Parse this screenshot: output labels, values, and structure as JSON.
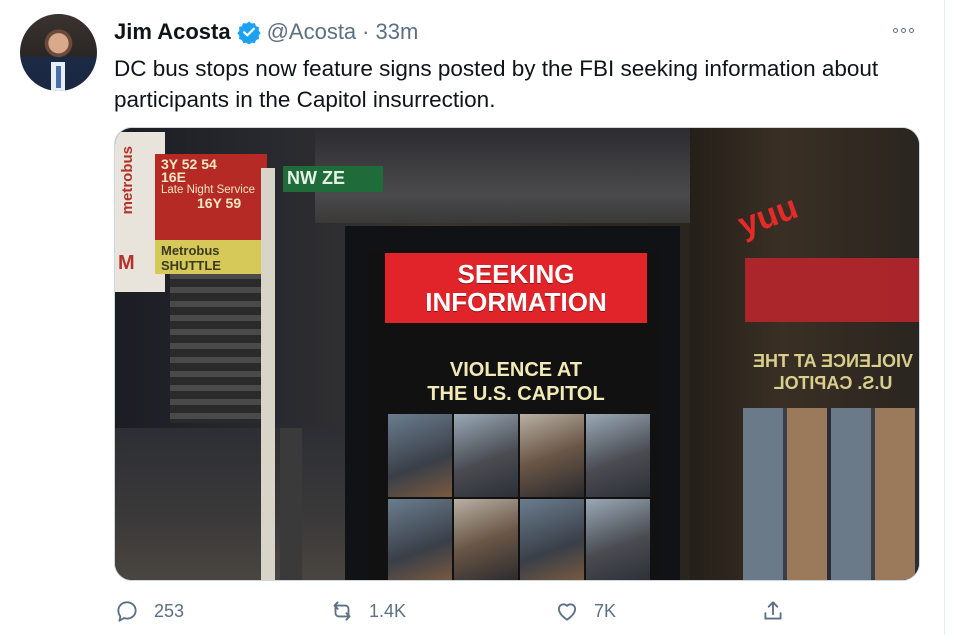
{
  "tweet": {
    "author": {
      "name": "Jim Acosta",
      "handle": "@Acosta",
      "separator": "·",
      "time": "33m"
    },
    "text": "DC bus stops now feature signs posted by the FBI seeking information about participants in the Capitol insurrection.",
    "media": {
      "ad_banner": "SEEKING INFORMATION",
      "ad_subtitle_line1": "VIOLENCE AT",
      "ad_subtitle_line2": "THE U.S. CAPITOL",
      "reflection_text": "VIOLENCE AT THE U.S. CAPITOL",
      "metro_sign": "metrobus",
      "metro_logo": "M",
      "route_sign_line1": "3Y 52 54",
      "route_sign_line2": "16E",
      "route_sign_line3": "Late Night Service",
      "route_sign_line4": "16Y 59",
      "route_yellow_line1": "Metrobus",
      "route_yellow_line2": "SHUTTLE",
      "street_sign": "NW ZE",
      "neon": "yuu"
    },
    "actions": {
      "replies": "253",
      "retweets": "1.4K",
      "likes": "7K"
    }
  },
  "colors": {
    "verified": "#1da1f2",
    "secondary_text": "#5b7083",
    "primary_text": "#0f1419",
    "ad_red": "#e0242a"
  },
  "icons": [
    "verified-badge-icon",
    "more-options-icon",
    "reply-icon",
    "retweet-icon",
    "like-icon",
    "share-icon"
  ]
}
